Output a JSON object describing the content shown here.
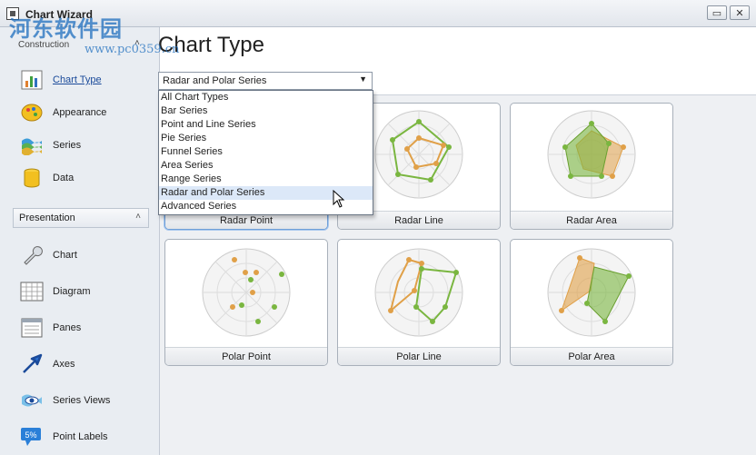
{
  "window": {
    "title": "Chart Wizard"
  },
  "watermark": {
    "text": "河东软件园",
    "url": "www.pc0359.cn"
  },
  "sidebar": {
    "construction_header": "Construction",
    "construction_items": [
      {
        "label": "Chart Type",
        "icon": "bar-chart-icon"
      },
      {
        "label": "Appearance",
        "icon": "palette-icon"
      },
      {
        "label": "Series",
        "icon": "series-icon"
      },
      {
        "label": "Data",
        "icon": "database-icon"
      }
    ],
    "presentation_header": "Presentation",
    "presentation_items": [
      {
        "label": "Chart",
        "icon": "wrench-icon"
      },
      {
        "label": "Diagram",
        "icon": "grid-icon"
      },
      {
        "label": "Panes",
        "icon": "panes-icon"
      },
      {
        "label": "Axes",
        "icon": "axes-arrow-icon"
      },
      {
        "label": "Series Views",
        "icon": "eye-icon"
      },
      {
        "label": "Point Labels",
        "icon": "percent-label-icon"
      }
    ]
  },
  "main": {
    "title": "Chart Type",
    "combo_value": "Radar and Polar Series"
  },
  "dropdown": {
    "options": [
      "All Chart Types",
      "Bar Series",
      "Point and Line Series",
      "Pie Series",
      "Funnel Series",
      "Area Series",
      "Range Series",
      "Radar and Polar Series",
      "Advanced Series"
    ],
    "highlighted": "Radar and Polar Series"
  },
  "gallery": [
    {
      "label": "Radar Point"
    },
    {
      "label": "Radar Line"
    },
    {
      "label": "Radar Area"
    },
    {
      "label": "Polar Point"
    },
    {
      "label": "Polar Line"
    },
    {
      "label": "Polar Area"
    }
  ],
  "colors": {
    "orange": "#e0a048",
    "green": "#7ab640",
    "accent": "#1a4a9a"
  }
}
